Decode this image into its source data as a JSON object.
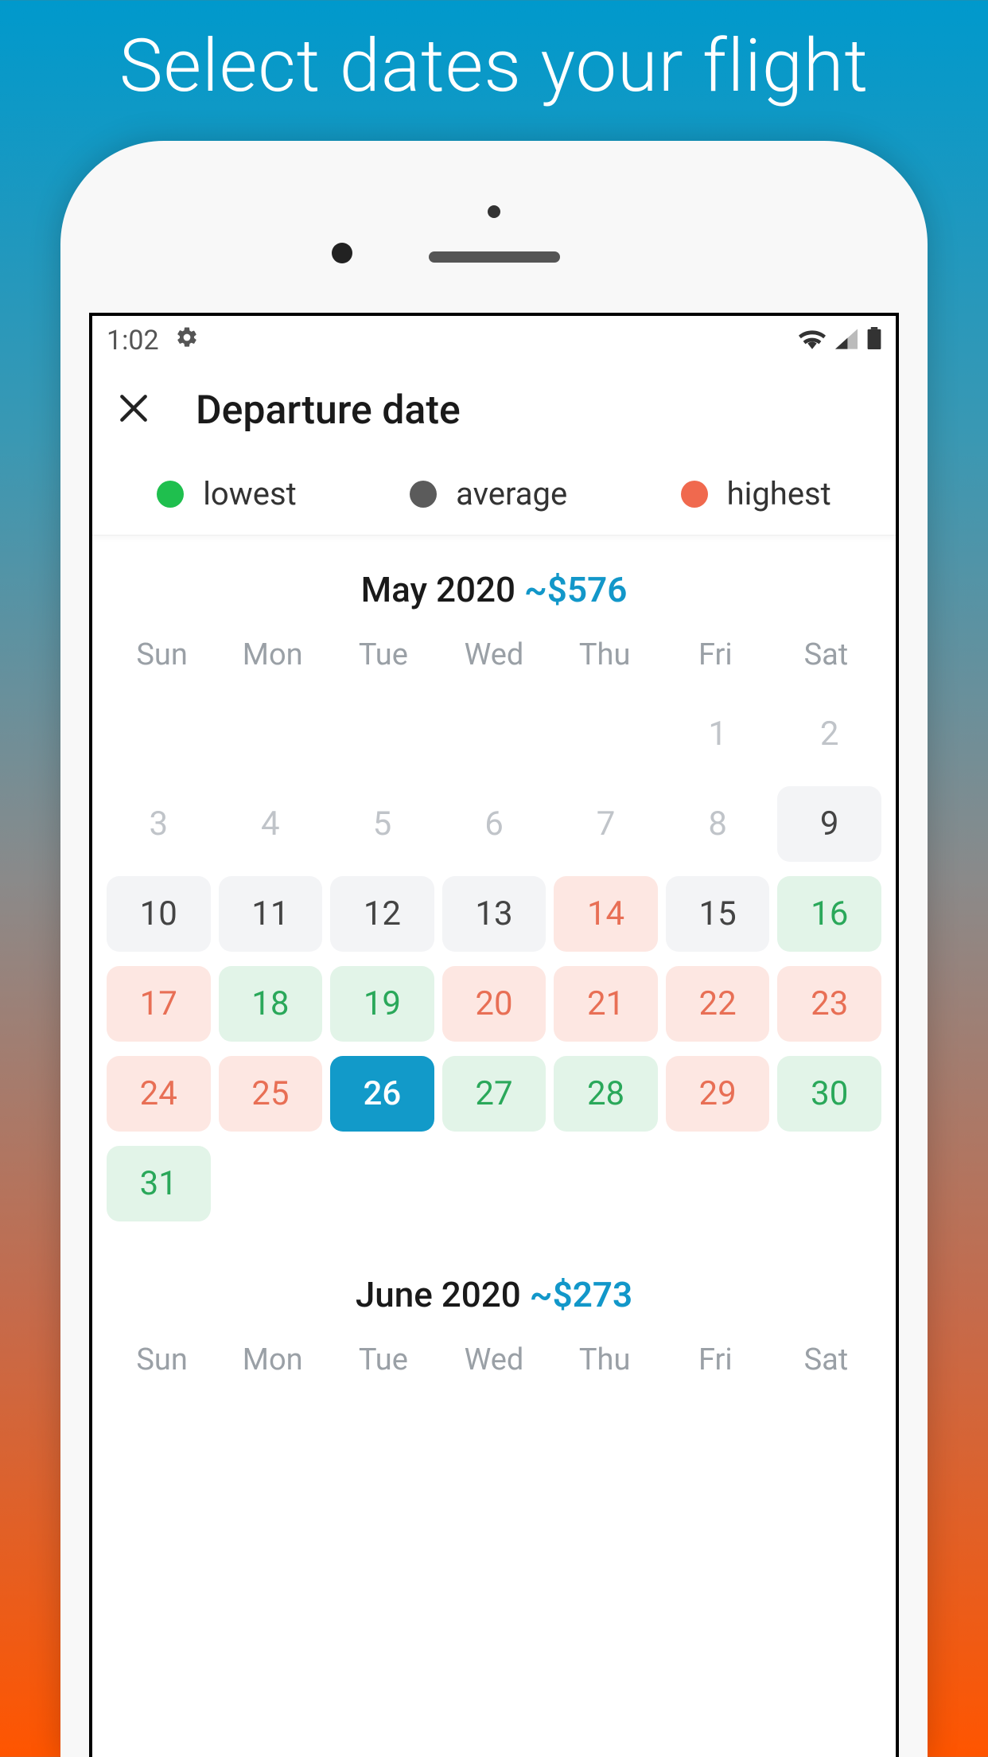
{
  "promo": {
    "title": "Select dates your flight"
  },
  "statusbar": {
    "time": "1:02"
  },
  "header": {
    "title": "Departure date"
  },
  "legend": {
    "items": [
      {
        "label": "lowest",
        "color": "#1fbf4e"
      },
      {
        "label": "average",
        "color": "#5b5b5b"
      },
      {
        "label": "highest",
        "color": "#f0694e"
      }
    ]
  },
  "dow": [
    "Sun",
    "Mon",
    "Tue",
    "Wed",
    "Thu",
    "Fri",
    "Sat"
  ],
  "months": [
    {
      "name": "May 2020",
      "price": "~$576",
      "startDow": 5,
      "days": [
        {
          "n": 1,
          "k": "past"
        },
        {
          "n": 2,
          "k": "past"
        },
        {
          "n": 3,
          "k": "past"
        },
        {
          "n": 4,
          "k": "past"
        },
        {
          "n": 5,
          "k": "past"
        },
        {
          "n": 6,
          "k": "past"
        },
        {
          "n": 7,
          "k": "past"
        },
        {
          "n": 8,
          "k": "past"
        },
        {
          "n": 9,
          "k": "neutral"
        },
        {
          "n": 10,
          "k": "average"
        },
        {
          "n": 11,
          "k": "average"
        },
        {
          "n": 12,
          "k": "average"
        },
        {
          "n": 13,
          "k": "average"
        },
        {
          "n": 14,
          "k": "highest"
        },
        {
          "n": 15,
          "k": "average"
        },
        {
          "n": 16,
          "k": "lowest"
        },
        {
          "n": 17,
          "k": "highest"
        },
        {
          "n": 18,
          "k": "lowest"
        },
        {
          "n": 19,
          "k": "lowest"
        },
        {
          "n": 20,
          "k": "highest"
        },
        {
          "n": 21,
          "k": "highest"
        },
        {
          "n": 22,
          "k": "highest"
        },
        {
          "n": 23,
          "k": "highest"
        },
        {
          "n": 24,
          "k": "highest"
        },
        {
          "n": 25,
          "k": "highest"
        },
        {
          "n": 26,
          "k": "selected"
        },
        {
          "n": 27,
          "k": "lowest"
        },
        {
          "n": 28,
          "k": "lowest"
        },
        {
          "n": 29,
          "k": "highest"
        },
        {
          "n": 30,
          "k": "lowest"
        },
        {
          "n": 31,
          "k": "lowest"
        }
      ]
    },
    {
      "name": "June 2020",
      "price": "~$273",
      "startDow": 1,
      "days": []
    }
  ]
}
